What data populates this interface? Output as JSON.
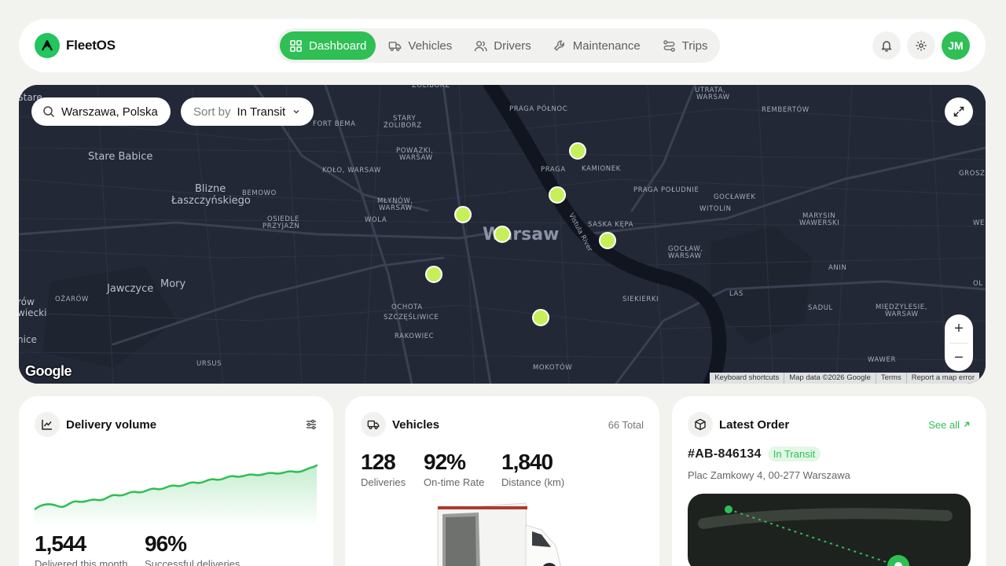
{
  "brand": {
    "name": "FleetOS"
  },
  "nav": {
    "items": [
      {
        "label": "Dashboard",
        "icon": "grid-icon",
        "active": true
      },
      {
        "label": "Vehicles",
        "icon": "truck-icon"
      },
      {
        "label": "Drivers",
        "icon": "users-icon"
      },
      {
        "label": "Maintenance",
        "icon": "wrench-icon"
      },
      {
        "label": "Trips",
        "icon": "route-icon"
      }
    ]
  },
  "header": {
    "avatar_initials": "JM"
  },
  "map": {
    "search_value": "Warszawa, Polska",
    "sort_label": "Sort by",
    "sort_value": "In Transit",
    "city_label": "Warsaw",
    "river_label": "Vistula River",
    "districts": [
      "ŻOLIBORZ",
      "PRAGA PÓŁNOC",
      "UTRATA, WARSAW",
      "REMBERTÓW",
      "Stare Babice",
      "FORT BEMA",
      "STARY ŻOLIBORZ",
      "POWĄZKI, WARSAW",
      "PRAGA",
      "KAMIONEK",
      "Blizne Łaszczyńskiego",
      "BEMOWO",
      "KOŁO, WARSAW",
      "PRAGA POŁUDNIE",
      "GOCŁAWEK",
      "WITOLIN",
      "MŁYNÓW, WARSAW",
      "WOLA",
      "OSIEDLE PRZYJAŹŃ",
      "SASKA KĘPA",
      "MARYSIN WAWERSKI",
      "GOCŁAW, WARSAW",
      "ANIN",
      "Mory",
      "Jawczyce",
      "OŻARÓW",
      "OCHOTA",
      "SZCZĘŚLIWICE",
      "SIEKIERKI",
      "LAS",
      "SADUL",
      "MIĘDZYLESIE, WARSAW",
      "RAKOWIEC",
      "URSUS",
      "MOKOTÓW",
      "WAWER",
      "Stare",
      "rów wiecki",
      "nice",
      "GROSZ",
      "WE",
      "OL"
    ],
    "attribution": [
      "Keyboard shortcuts",
      "Map data ©2026 Google",
      "Terms",
      "Report a map error"
    ],
    "google_logo": "Google",
    "zoom_in": "+",
    "zoom_out": "−",
    "marker_color": "#c6f05a"
  },
  "delivery_volume": {
    "title": "Delivery volume",
    "stats": [
      {
        "value": "1,544",
        "label": "Delivered this month"
      },
      {
        "value": "96%",
        "label": "Successful deliveries"
      }
    ]
  },
  "vehicles": {
    "title": "Vehicles",
    "total": "66 Total",
    "stats": [
      {
        "value": "128",
        "label": "Deliveries"
      },
      {
        "value": "92%",
        "label": "On-time Rate"
      },
      {
        "value": "1,840",
        "label": "Distance (km)"
      }
    ]
  },
  "latest_order": {
    "title": "Latest Order",
    "see_all": "See all",
    "order_id": "#AB-846134",
    "status": "In Transit",
    "address": "Plac Zamkowy 4, 00-277 Warszawa"
  },
  "colors": {
    "accent": "#2fbf55",
    "map_bg": "#232836"
  }
}
